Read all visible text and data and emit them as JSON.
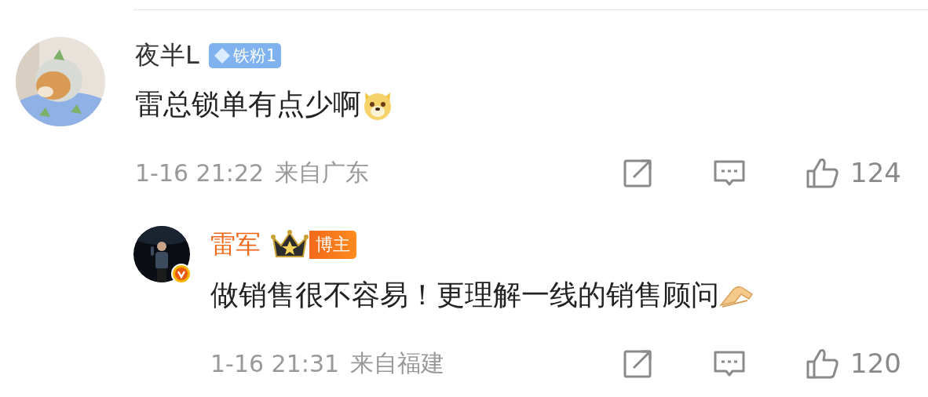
{
  "comments": [
    {
      "kind": "comment",
      "author": "夜半L",
      "author_highlight": false,
      "badge": {
        "kind": "fan",
        "label": "铁粉1"
      },
      "avatar": {
        "kind": "dog",
        "verified": false
      },
      "text": "雷总锁单有点少啊",
      "emoji": {
        "kind": "doge"
      },
      "time": "1-16 21:22",
      "location": "来自广东",
      "likes": "124"
    },
    {
      "kind": "reply",
      "author": "雷军",
      "author_highlight": true,
      "badge": {
        "kind": "host",
        "label": "博主"
      },
      "avatar": {
        "kind": "person",
        "verified": true
      },
      "text": "做销售很不容易！更理解一线的销售顾问",
      "emoji": {
        "kind": "hands"
      },
      "time": "1-16 21:31",
      "location": "来自福建",
      "likes": "120"
    }
  ]
}
